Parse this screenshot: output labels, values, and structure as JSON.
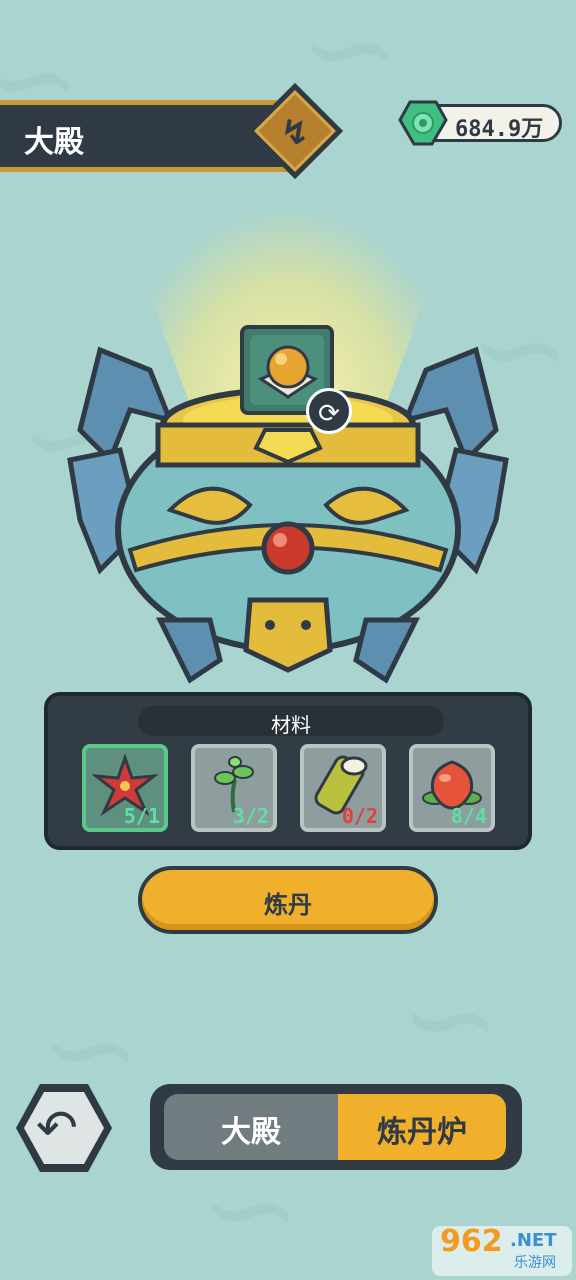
{
  "header": {
    "title": "大殿",
    "badge": "↯"
  },
  "currency": {
    "value": "684.9万",
    "icon": "jade-gem-icon"
  },
  "product": {
    "icon": "golden-pill-icon",
    "swap_icon": "swap-icon",
    "swap_glyph": "⟳"
  },
  "materials": {
    "title": "材料",
    "items": [
      {
        "name": "red-flower",
        "count": "5/1",
        "state": "enough",
        "color": "#5fe0a3"
      },
      {
        "name": "green-herb",
        "count": "3/2",
        "state": "enough",
        "color": "#5fe0a3"
      },
      {
        "name": "bamboo-tube",
        "count": "0/2",
        "state": "lacking",
        "color": "#e0413e"
      },
      {
        "name": "peach-fruit",
        "count": "8/4",
        "state": "enough",
        "color": "#5fe0a3"
      }
    ]
  },
  "actions": {
    "craft_label": "炼丹",
    "back_glyph": "↶"
  },
  "tabs": [
    {
      "label": "大殿",
      "selected": false
    },
    {
      "label": "炼丹炉",
      "selected": true
    }
  ],
  "watermark": {
    "num": "962",
    "net": ".NET",
    "sub": "乐游网"
  },
  "colors": {
    "accent": "#f1b02c",
    "dark": "#2f3a44",
    "background": "#a9d4cf"
  }
}
